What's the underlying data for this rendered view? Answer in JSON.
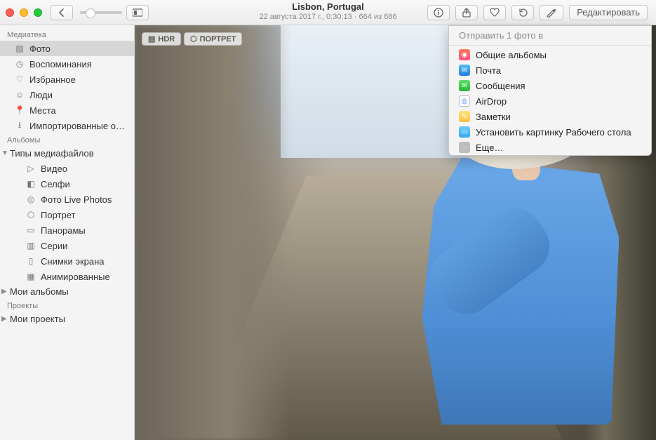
{
  "titlebar": {
    "title": "Lisbon, Portugal",
    "subtitle": "22 августа 2017 г., 0:30:13  ·  664 из 686",
    "edit_label": "Редактировать"
  },
  "sidebar": {
    "headers": {
      "library": "Медиатека",
      "albums": "Альбомы",
      "projects": "Проекты"
    },
    "library": [
      {
        "icon": "photo-stack-icon",
        "label": "Фото",
        "selected": true
      },
      {
        "icon": "memories-icon",
        "label": "Воспоминания"
      },
      {
        "icon": "heart-icon",
        "label": "Избранное"
      },
      {
        "icon": "people-icon",
        "label": "Люди"
      },
      {
        "icon": "places-icon",
        "label": "Места"
      },
      {
        "icon": "import-icon",
        "label": "Импортированные о…"
      }
    ],
    "mediatypes_label": "Типы медиафайлов",
    "mediatypes": [
      {
        "icon": "video-icon",
        "label": "Видео"
      },
      {
        "icon": "selfie-icon",
        "label": "Селфи"
      },
      {
        "icon": "live-icon",
        "label": "Фото Live Photos"
      },
      {
        "icon": "portrait-icon",
        "label": "Портрет"
      },
      {
        "icon": "panorama-icon",
        "label": "Панорамы"
      },
      {
        "icon": "burst-icon",
        "label": "Серии"
      },
      {
        "icon": "screenshot-icon",
        "label": "Снимки экрана"
      },
      {
        "icon": "animated-icon",
        "label": "Анимированные"
      }
    ],
    "my_albums_label": "Мои альбомы",
    "my_projects_label": "Мои проекты"
  },
  "badges": {
    "hdr": "HDR",
    "portrait": "ПОРТРЕТ"
  },
  "share_menu": {
    "title": "Отправить 1 фото в",
    "items": [
      {
        "icon": "ic-cloud",
        "label": "Общие альбомы"
      },
      {
        "icon": "ic-mail",
        "label": "Почта"
      },
      {
        "icon": "ic-msg",
        "label": "Сообщения"
      },
      {
        "icon": "ic-air",
        "label": "AirDrop"
      },
      {
        "icon": "ic-notes",
        "label": "Заметки"
      },
      {
        "icon": "ic-desk",
        "label": "Установить картинку Рабочего стола"
      },
      {
        "icon": "ic-more",
        "label": "Еще…"
      }
    ]
  }
}
